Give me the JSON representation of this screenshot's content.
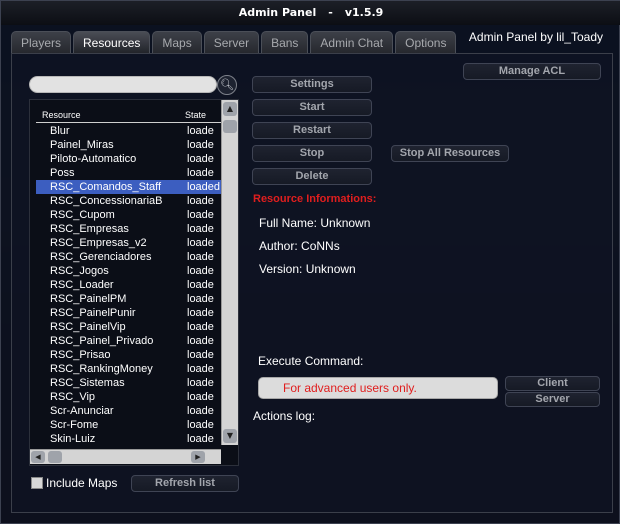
{
  "window": {
    "title": "Admin Panel",
    "separator": "-",
    "version": "v1.5.9",
    "credit": "Admin Panel by lil_Toady"
  },
  "tabs": [
    {
      "label": "Players",
      "active": false
    },
    {
      "label": "Resources",
      "active": true
    },
    {
      "label": "Maps",
      "active": false
    },
    {
      "label": "Server",
      "active": false
    },
    {
      "label": "Bans",
      "active": false
    },
    {
      "label": "Admin Chat",
      "active": false
    },
    {
      "label": "Options",
      "active": false
    }
  ],
  "resources": {
    "search_value": "",
    "columns": {
      "name": "Resource",
      "state": "State"
    },
    "rows": [
      {
        "name": "Blur",
        "state": "loade"
      },
      {
        "name": "Painel_Miras",
        "state": "loade"
      },
      {
        "name": "Piloto-Automatico",
        "state": "loade"
      },
      {
        "name": "Poss",
        "state": "loade"
      },
      {
        "name": "RSC_Comandos_Staff",
        "state": "loaded",
        "selected": true
      },
      {
        "name": "RSC_ConcessionariaB",
        "state": "loade"
      },
      {
        "name": "RSC_Cupom",
        "state": "loade"
      },
      {
        "name": "RSC_Empresas",
        "state": "loade"
      },
      {
        "name": "RSC_Empresas_v2",
        "state": "loade"
      },
      {
        "name": "RSC_Gerenciadores",
        "state": "loade"
      },
      {
        "name": "RSC_Jogos",
        "state": "loade"
      },
      {
        "name": "RSC_Loader",
        "state": "loade"
      },
      {
        "name": "RSC_PainelPM",
        "state": "loade"
      },
      {
        "name": "RSC_PainelPunir",
        "state": "loade"
      },
      {
        "name": "RSC_PainelVip",
        "state": "loade"
      },
      {
        "name": "RSC_Painel_Privado",
        "state": "loade"
      },
      {
        "name": "RSC_Prisao",
        "state": "loade"
      },
      {
        "name": "RSC_RankingMoney",
        "state": "loade"
      },
      {
        "name": "RSC_Sistemas",
        "state": "loade"
      },
      {
        "name": "RSC_Vip",
        "state": "loade"
      },
      {
        "name": "Scr-Anunciar",
        "state": "loade"
      },
      {
        "name": "Scr-Fome",
        "state": "loade"
      },
      {
        "name": "Skin-Luiz",
        "state": "loade"
      }
    ],
    "include_maps_label": "Include Maps",
    "include_maps_checked": false,
    "refresh_label": "Refresh list"
  },
  "actions": {
    "manage_acl": "Manage ACL",
    "settings": "Settings",
    "start": "Start",
    "restart": "Restart",
    "stop": "Stop",
    "delete": "Delete",
    "stop_all": "Stop All Resources"
  },
  "info": {
    "title": "Resource Informations:",
    "full_name": "Full Name: Unknown",
    "author": "Author: CoNNs",
    "version": "Version: Unknown"
  },
  "execute": {
    "label": "Execute Command:",
    "placeholder": "For advanced users only.",
    "client": "Client",
    "server": "Server"
  },
  "log": {
    "label": "Actions log:"
  },
  "colors": {
    "accent_red": "#e01e1e",
    "selection": "#3c5ec0"
  }
}
